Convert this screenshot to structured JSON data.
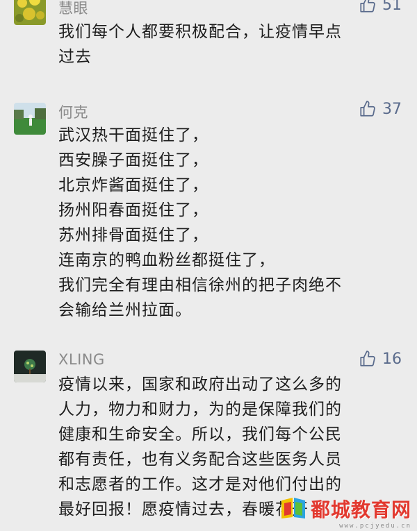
{
  "comments": [
    {
      "user": "慧眼",
      "likes": "51",
      "lines": [
        "我们每个人都要积极配合，让疫情早点",
        "过去"
      ]
    },
    {
      "user": "何克",
      "likes": "37",
      "lines": [
        "武汉热干面挺住了，",
        "西安臊子面挺住了，",
        "北京炸酱面挺住了，",
        "扬州阳春面挺住了，",
        "苏州排骨面挺住了，",
        "连南京的鸭血粉丝都挺住了，",
        "我们完全有理由相信徐州的把子肉绝不",
        "会输给兰州拉面。"
      ]
    },
    {
      "user": "XLING",
      "likes": "16",
      "lines": [
        "疫情以来，国家和政府出动了这么多的",
        "人力，物力和财力，为的是保障我们的",
        "健康和生命安全。所以，我们每个公民",
        "都有责任，也有义务配合这些医务人员",
        "和志愿者的工作。这才是对他们付出的",
        "最好回报！愿疫情过去，春暖花开"
      ]
    }
  ],
  "watermark": {
    "text": "鄱城教育网",
    "sub": "www.pcjyedu.cn"
  },
  "colors": {
    "background": "#ececec",
    "username": "#8a8a8a",
    "like": "#5a6b8c",
    "watermark": "#e2392f"
  },
  "icons": {
    "like": "thumbs-up-icon"
  }
}
